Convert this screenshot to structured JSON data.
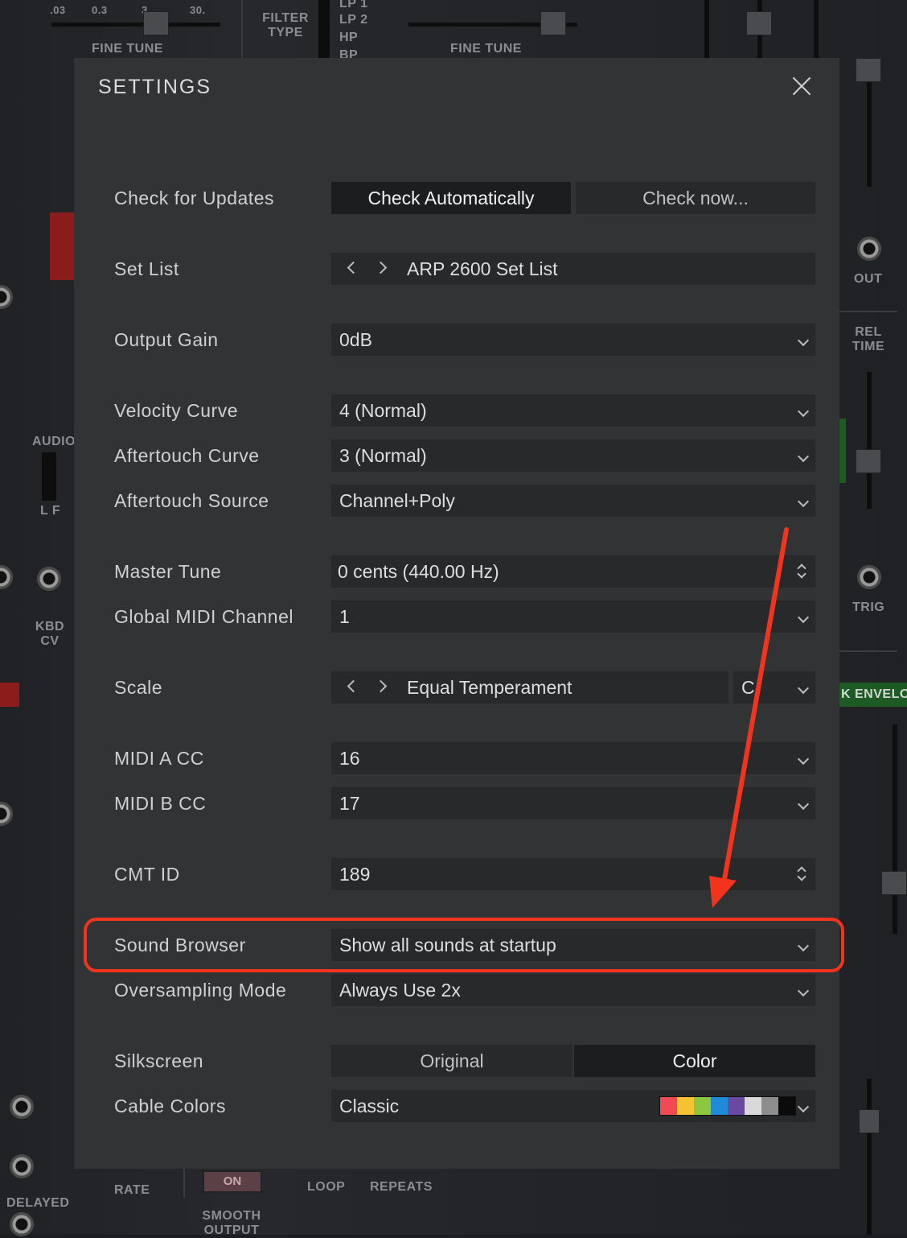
{
  "background": {
    "labels": {
      "fine_tune_left": "FINE TUNE",
      "fine_tune_mid": "FINE TUNE",
      "filter_type": "FILTER TYPE",
      "lp1": "LP 1",
      "lp2": "LP 2",
      "hp": "HP",
      "bp": "BP",
      "out": "OUT",
      "rel_time": "REL TIME",
      "trig": "TRIG",
      "kbd_cv": "KBD CV",
      "audio": "AUDIO",
      "lf": "L F",
      "rate": "RATE",
      "on": "ON",
      "loop": "LOOP",
      "repeats": "REPEATS",
      "smooth_output": "SMOOTH OUTPUT",
      "delayed": "DELAYED",
      "envelope": "K ENVELO",
      "scale_ticks": [
        ".03",
        "0.3",
        "3",
        "30."
      ]
    }
  },
  "modal": {
    "title": "SETTINGS",
    "rows": {
      "check_updates": {
        "label": "Check for Updates",
        "options": [
          "Check Automatically",
          "Check now..."
        ]
      },
      "set_list": {
        "label": "Set List",
        "value": "ARP 2600 Set List"
      },
      "output_gain": {
        "label": "Output Gain",
        "value": "0dB"
      },
      "velocity_curve": {
        "label": "Velocity Curve",
        "value": "4 (Normal)"
      },
      "aftertouch_curve": {
        "label": "Aftertouch Curve",
        "value": "3 (Normal)"
      },
      "aftertouch_source": {
        "label": "Aftertouch Source",
        "value": "Channel+Poly"
      },
      "master_tune": {
        "label": "Master Tune",
        "value": "0 cents (440.00 Hz)"
      },
      "global_midi_channel": {
        "label": "Global MIDI Channel",
        "value": "1"
      },
      "scale": {
        "label": "Scale",
        "value": "Equal Temperament",
        "key": "C"
      },
      "midi_a_cc": {
        "label": "MIDI A CC",
        "value": "16"
      },
      "midi_b_cc": {
        "label": "MIDI B CC",
        "value": "17"
      },
      "cmt_id": {
        "label": "CMT ID",
        "value": "189"
      },
      "sound_browser": {
        "label": "Sound Browser",
        "value": "Show all sounds at startup"
      },
      "oversampling_mode": {
        "label": "Oversampling Mode",
        "value": "Always Use 2x"
      },
      "silkscreen": {
        "label": "Silkscreen",
        "options": [
          "Original",
          "Color"
        ]
      },
      "cable_colors": {
        "label": "Cable Colors",
        "value": "Classic",
        "swatches": [
          "#f24a55",
          "#f5c231",
          "#8dc63f",
          "#1f8ad6",
          "#6a4aa0",
          "#d9d9d9",
          "#8d8d8d",
          "#0b0b0b"
        ]
      }
    }
  },
  "colors": {
    "annotation": "#f2331e",
    "modal_bg": "#323334",
    "control_bg": "#28292a"
  }
}
